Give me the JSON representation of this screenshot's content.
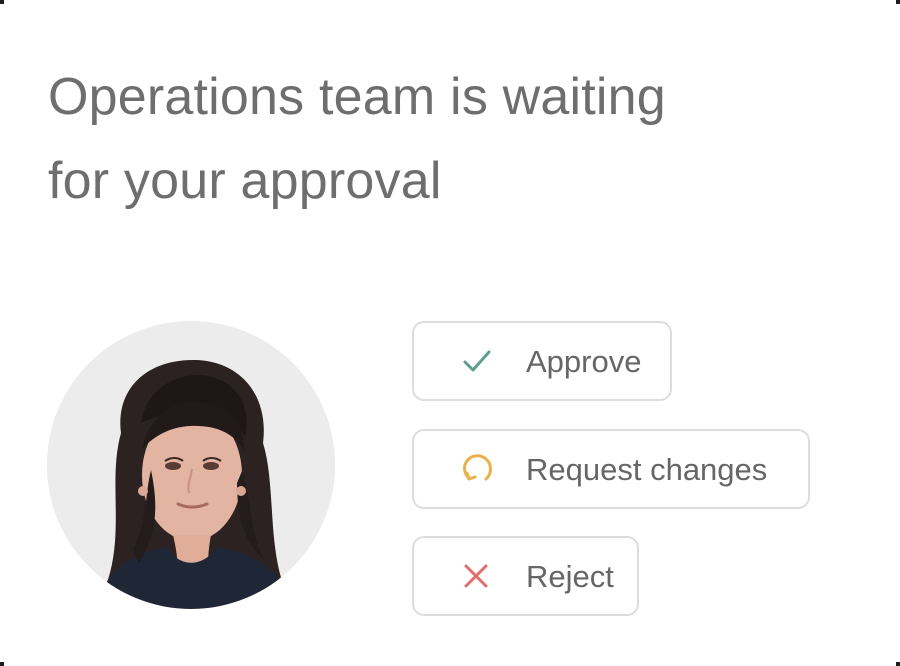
{
  "headline": {
    "line1": "Operations team is waiting",
    "line2": "for your approval"
  },
  "actions": [
    {
      "label": "Approve",
      "icon": "check-icon",
      "color": "#5f9e8f"
    },
    {
      "label": "Request changes",
      "icon": "refresh-icon",
      "color": "#e8b24a"
    },
    {
      "label": "Reject",
      "icon": "close-icon",
      "color": "#e36d6d"
    }
  ],
  "avatar": {
    "icon": "person-photo"
  },
  "colors": {
    "background": "#ffffff",
    "text": "#6e6e6e",
    "button_border": "#dddddd"
  }
}
